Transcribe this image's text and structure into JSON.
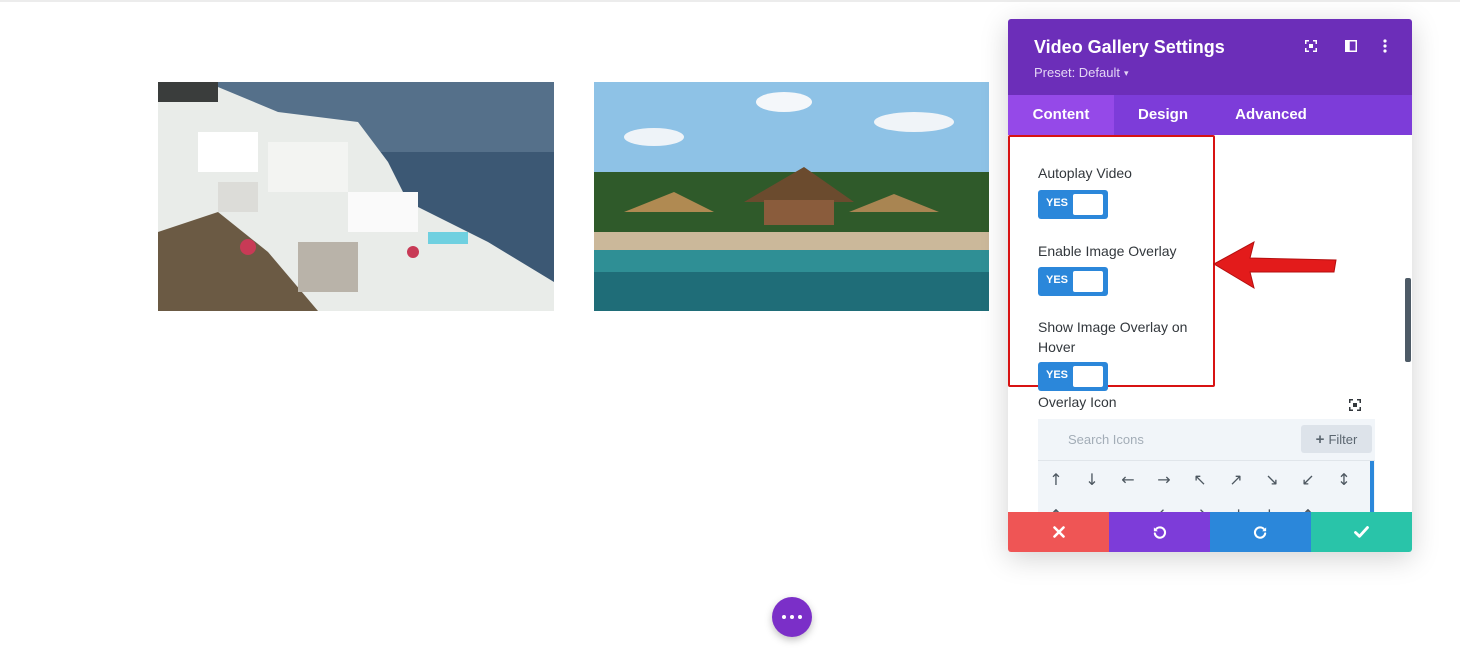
{
  "panel": {
    "title": "Video Gallery Settings",
    "preset": "Preset: Default",
    "tabs": [
      "Content",
      "Design",
      "Advanced"
    ]
  },
  "settings": {
    "autoplay_label": "Autoplay Video",
    "autoplay_value": "YES",
    "overlay_label": "Enable Image Overlay",
    "overlay_value": "YES",
    "hover_label_line1": "Show Image Overlay on",
    "hover_label_line2": "Hover",
    "hover_value": "YES",
    "overlay_icon_label": "Overlay Icon"
  },
  "icon_picker": {
    "search_placeholder": "Search Icons",
    "filter_label": "Filter",
    "icons_row1": [
      "↑",
      "↓",
      "←",
      "→",
      "↖",
      "↗",
      "↘",
      "↙",
      "↕"
    ],
    "icons_row2": [
      "↕",
      "↔",
      "↔",
      "↰",
      "↱",
      "↲",
      "↳",
      "↕"
    ]
  },
  "colors": {
    "header": "#6c2eb9",
    "active_tab": "#9549e8",
    "toggle": "#2b87da",
    "highlight": "#d81313",
    "discard": "#ef5555",
    "save": "#29c4a9"
  }
}
